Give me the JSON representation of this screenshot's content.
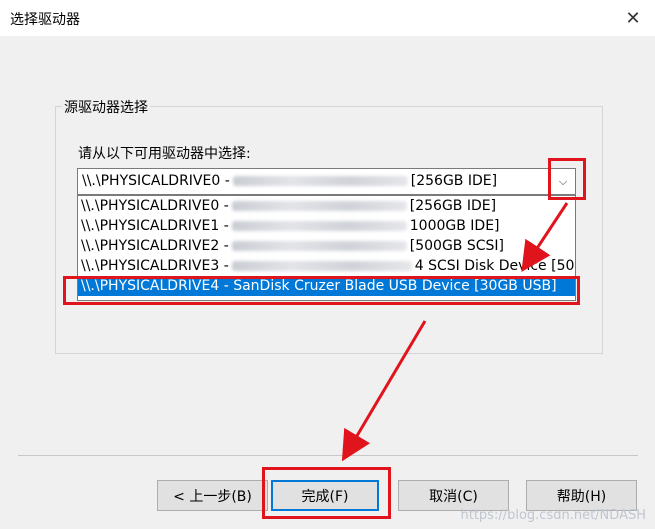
{
  "window": {
    "title": "选择驱动器",
    "close_glyph": "✕"
  },
  "group": {
    "title": "源驱动器选择",
    "prompt": "请从以下可用驱动器中选择:"
  },
  "combo": {
    "selected_prefix": "\\\\.\\PHYSICALDRIVE0 -",
    "selected_suffix": "[256GB IDE]",
    "arrow_glyph": "⌵"
  },
  "dropdown": {
    "items": [
      {
        "prefix": "\\\\.\\PHYSICALDRIVE0 -",
        "suffix": "[256GB IDE]"
      },
      {
        "prefix": "\\\\.\\PHYSICALDRIVE1 -",
        "suffix": "1000GB IDE]"
      },
      {
        "prefix": "\\\\.\\PHYSICALDRIVE2 -",
        "suffix": "[500GB SCSI]"
      },
      {
        "prefix": "\\\\.\\PHYSICALDRIVE3 -",
        "suffix": "4 SCSI Disk Device [50"
      },
      {
        "text": "\\\\.\\PHYSICALDRIVE4 - SanDisk Cruzer Blade USB Device [30GB USB]"
      }
    ],
    "selected_index": 4
  },
  "buttons": {
    "back": "< 上一步(B)",
    "finish": "完成(F)",
    "cancel": "取消(C)",
    "help": "帮助(H)"
  },
  "watermark": "https://blog.csdn.net/NDASH",
  "colors": {
    "annotation": "#e0141c",
    "selection": "#0078d7"
  }
}
